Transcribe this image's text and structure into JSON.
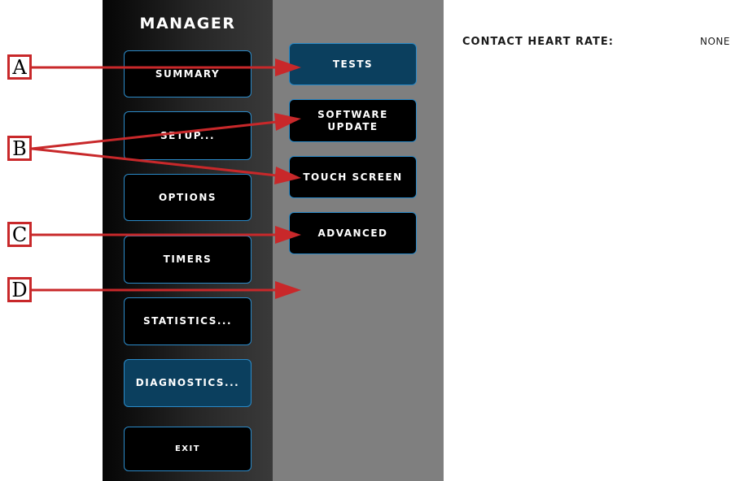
{
  "manager_panel": {
    "title": "MANAGER",
    "buttons": [
      {
        "label": "SUMMARY"
      },
      {
        "label": "SETUP..."
      },
      {
        "label": "OPTIONS"
      },
      {
        "label": "TIMERS"
      },
      {
        "label": "STATISTICS..."
      },
      {
        "label": "DIAGNOSTICS..."
      },
      {
        "label": "EXIT"
      }
    ]
  },
  "diagnostics_submenu": {
    "buttons": [
      {
        "label": "TESTS"
      },
      {
        "label": "SOFTWARE UPDATE"
      },
      {
        "label": "TOUCH SCREEN"
      },
      {
        "label": "ADVANCED"
      }
    ]
  },
  "status": {
    "contact_heart_rate_label": "CONTACT HEART RATE:",
    "contact_heart_rate_value": "NONE"
  },
  "callouts": [
    "A",
    "B",
    "C",
    "D"
  ],
  "colors": {
    "accent_border": "#2b8ac8",
    "active_button": "#0b3f5e",
    "callout_red": "#c8282a",
    "submenu_background": "#7f7f7f"
  }
}
